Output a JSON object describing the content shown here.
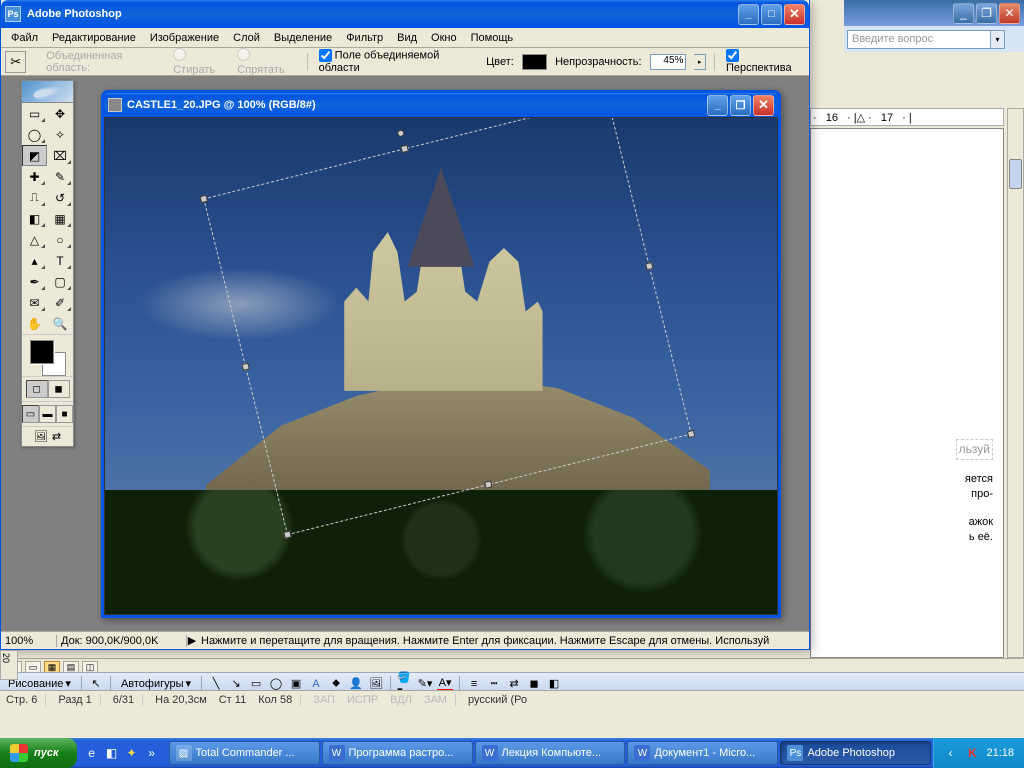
{
  "word": {
    "help_placeholder": "Введите вопрос",
    "ruler": [
      "16",
      "17"
    ],
    "page_text": [
      "льзуй",
      "яется",
      "про-",
      "",
      "ажок",
      "ь её."
    ],
    "viewmodes": [
      "≡",
      "▭",
      "▦",
      "▤",
      "◫"
    ],
    "draw": {
      "label": "Рисование",
      "autoshapes": "Автофигуры"
    },
    "status": {
      "page": "Стр. 6",
      "section": "Разд 1",
      "pages": "6/31",
      "at": "На 20,3см",
      "line": "Ст 11",
      "col": "Кол 58",
      "rec": "ЗАП",
      "trk": "ИСПР",
      "ext": "ВДЛ",
      "ovr": "ЗАМ",
      "lang": "русский (Ро"
    }
  },
  "ps": {
    "title": "Adobe Photoshop",
    "menu": [
      "Файл",
      "Редактирование",
      "Изображение",
      "Слой",
      "Выделение",
      "Фильтр",
      "Вид",
      "Окно",
      "Помощь"
    ],
    "options": {
      "label_area": "Объединенная область:",
      "erase": "Стирать",
      "hide": "Спрятать",
      "field": "Поле объединяемой области",
      "color": "Цвет:",
      "opacity": "Непрозрачность:",
      "opacity_val": "45%",
      "perspective": "Перспектива"
    },
    "doc_title": "CASTLE1_20.JPG @ 100% (RGB/8#)",
    "status": {
      "zoom": "100%",
      "doc": "Док: 900,0K/900,0K",
      "hint": "Нажмите и перетащите для вращения. Нажмите Enter для фиксации. Нажмите Escape для отмены. Используй"
    },
    "jump": "⇄",
    "vruler": "20"
  },
  "taskbar": {
    "start": "пуск",
    "tasks": [
      {
        "label": "Total Commander ...",
        "icon": "▧"
      },
      {
        "label": "Программа растро...",
        "icon": "W"
      },
      {
        "label": "Лекция Компьюте...",
        "icon": "W"
      },
      {
        "label": "Документ1 - Micro...",
        "icon": "W"
      },
      {
        "label": "Adobe Photoshop",
        "icon": "Ps",
        "active": true
      }
    ],
    "clock": "21:18"
  }
}
